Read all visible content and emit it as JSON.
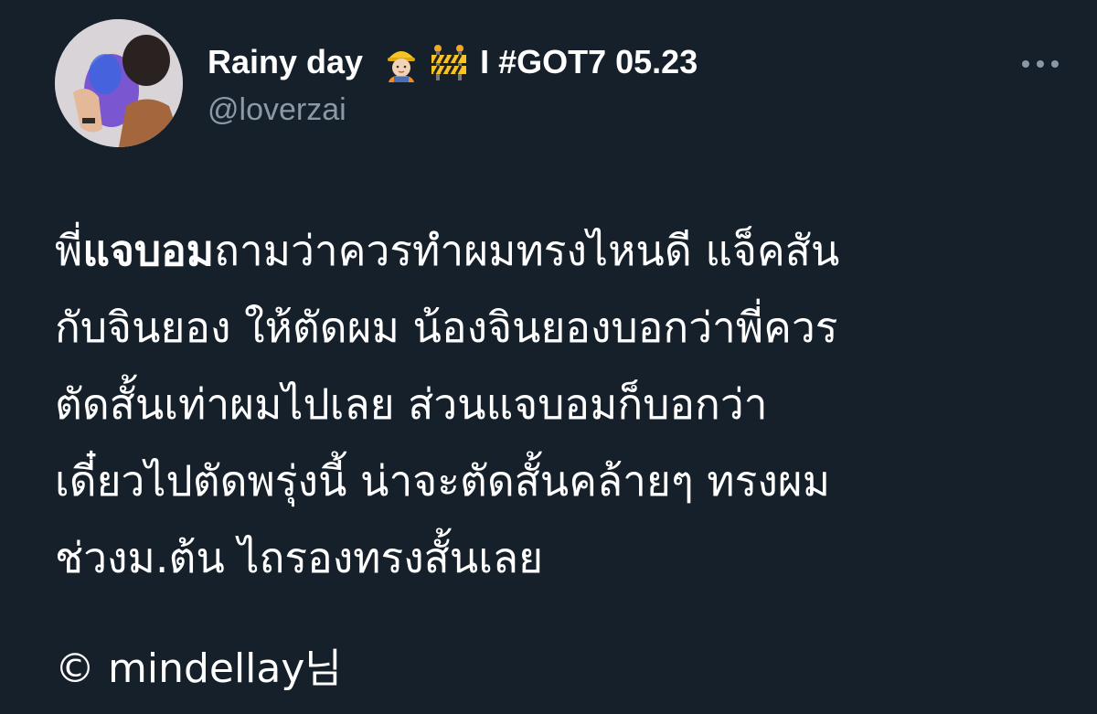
{
  "author": {
    "display_name": "Rainy day",
    "emojis": [
      "construction-worker-emoji",
      "construction-barrier-emoji"
    ],
    "name_suffix": "I #GOT7 05.23",
    "handle": "@loverzai"
  },
  "tweet": {
    "lines": [
      {
        "bold": "แจบอม",
        "prefix": "พี่",
        "rest": "ถามว่าควรทำผมทรงไหนดี แจ็คสัน"
      },
      {
        "text": "กับจินยอง ให้ตัดผม น้องจินยองบอกว่าพี่ควร"
      },
      {
        "text": "ตัดสั้นเท่าผมไปเลย ส่วนแจบอมก็บอกว่า"
      },
      {
        "text": "เดี๋ยวไปตัดพรุ่งนี้ น่าจะตัดสั้นคล้ายๆ ทรงผม"
      },
      {
        "text": "ช่วงม.ต้น ไถรองทรงสั้นเลย"
      }
    ],
    "credit": "© mindellay님"
  },
  "colors": {
    "background": "#15202b",
    "primary_text": "#ffffff",
    "secondary_text": "#8b98a5"
  },
  "icons": {
    "more": "more-dots-icon"
  }
}
